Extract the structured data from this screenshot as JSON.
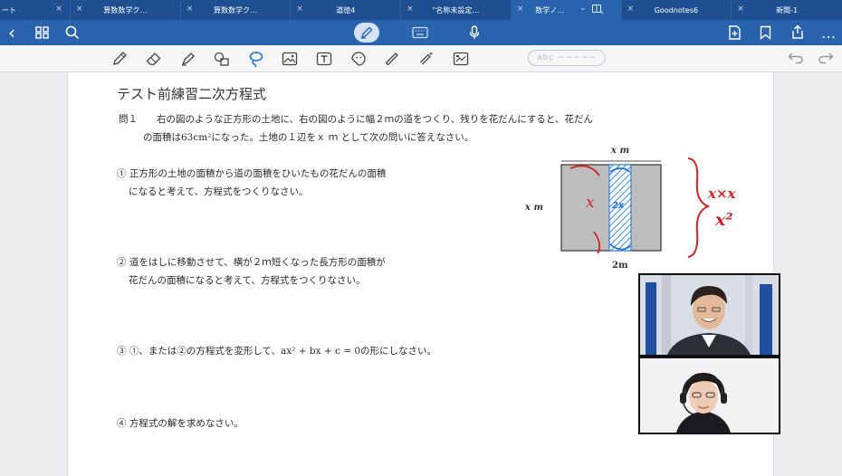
{
  "tabs": [
    {
      "label": "ート"
    },
    {
      "label": "算数数学ク…"
    },
    {
      "label": "算数数学ク…"
    },
    {
      "label": "道徳4"
    },
    {
      "label": "\"名称未設定…"
    },
    {
      "label": "数学ノ…"
    },
    {
      "label": "Goodnotes6"
    },
    {
      "label": "新聞-1"
    }
  ],
  "icons": {
    "close": "×",
    "back": "‹",
    "grid": "▦",
    "search": "⌕",
    "more": "…",
    "chevron": "⌄"
  },
  "toolbar": {
    "text_tool_preview": "abc ~~~~~"
  },
  "document": {
    "title": "テスト前練習二次方程式",
    "question_number": "問１",
    "question_line1": "右の図のような正方形の土地に、右の図のように幅２ｍの道をつくり、残りを花だんにすると、花だん",
    "question_line2": "の面積は63cm²になった。土地の１辺をｘ ｍ として次の問いに答えなさい。",
    "items": [
      {
        "label": "① 正方形の土地の面積から道の面積をひいたもの花だんの面積",
        "cont": "になると考えて、方程式をつくりなさい。"
      },
      {
        "label": "② 道をはしに移動させて、横が２ｍ短くなった長方形の面積が",
        "cont": "花だんの面積になると考えて、方程式をつくりなさい。"
      },
      {
        "label": "③ ①、または②の方程式を変形して、ax² + bx + c = 0の形にしなさい。",
        "cont": ""
      },
      {
        "label": "④ 方程式の解を求めなさい。",
        "cont": ""
      }
    ]
  },
  "diagram": {
    "top_label": "x m",
    "left_label": "x m",
    "bottom_label": "2m",
    "handwriting": {
      "x_in_square": "x",
      "road_note": "2x",
      "note_line1": "x×x",
      "note_line2": "x²"
    }
  },
  "colors": {
    "tab_bar": "#1e4f91",
    "nav_bar": "#2a63ad",
    "square_fill": "#bdbdbd",
    "road_hatch": "#3a8ee6",
    "ink_red": "#d32222"
  }
}
